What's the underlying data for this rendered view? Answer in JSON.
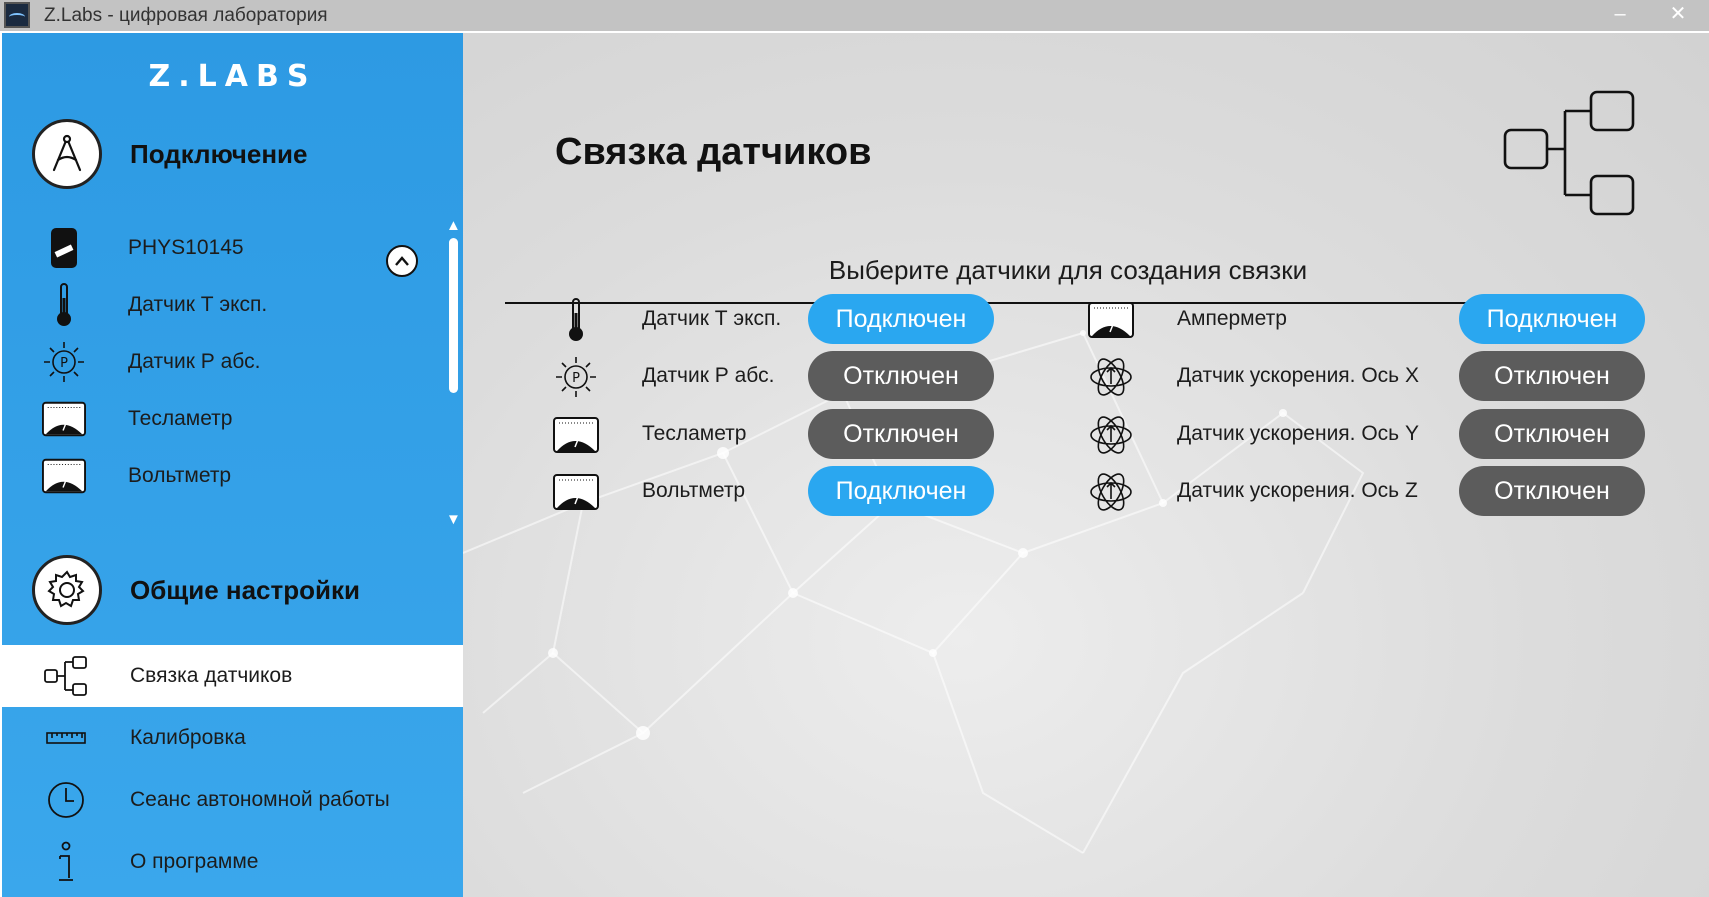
{
  "window": {
    "title": "Z.Labs - цифровая лаборатория",
    "minimize_glyph": "–",
    "close_glyph": "✕"
  },
  "sidebar": {
    "logo": "Z.LABS",
    "connection": {
      "title": "Подключение",
      "icon": "compass-icon",
      "device": {
        "label": "PHYS10145",
        "icon": "device-icon"
      },
      "sensors": [
        {
          "label": "Датчик Т эксп.",
          "icon": "thermometer-icon"
        },
        {
          "label": "Датчик Р абс.",
          "icon": "pressure-icon"
        },
        {
          "label": "Тесламетр",
          "icon": "gauge-icon"
        },
        {
          "label": "Вольтметр",
          "icon": "gauge-icon"
        }
      ]
    },
    "settings": {
      "title": "Общие настройки",
      "icon": "gear-icon",
      "items": [
        {
          "label": "Связка датчиков",
          "icon": "tree-icon",
          "active": true
        },
        {
          "label": "Калибровка",
          "icon": "ruler-icon",
          "active": false
        },
        {
          "label": "Сеанс автономной работы",
          "icon": "clock-icon",
          "active": false
        },
        {
          "label": "О программе",
          "icon": "info-icon",
          "active": false
        }
      ]
    }
  },
  "main": {
    "title": "Связка датчиков",
    "subtitle": "Выберите датчики для создания связки",
    "left_sensors": [
      {
        "label": "Датчик Т эксп.",
        "icon": "thermometer-icon",
        "status": "Подключен",
        "connected": true
      },
      {
        "label": "Датчик Р абс.",
        "icon": "pressure-icon",
        "status": "Отключен",
        "connected": false
      },
      {
        "label": "Тесламетр",
        "icon": "gauge-icon",
        "status": "Отключен",
        "connected": false
      },
      {
        "label": "Вольтметр",
        "icon": "gauge-icon",
        "status": "Подключен",
        "connected": true
      }
    ],
    "right_sensors": [
      {
        "label": "Амперметр",
        "icon": "gauge-icon",
        "status": "Подключен",
        "connected": true
      },
      {
        "label": "Датчик ускорения. Ось X",
        "icon": "accelerometer-icon",
        "status": "Отключен",
        "connected": false
      },
      {
        "label": "Датчик ускорения. Ось Y",
        "icon": "accelerometer-icon",
        "status": "Отключен",
        "connected": false
      },
      {
        "label": "Датчик ускорения. Ось Z",
        "icon": "accelerometer-icon",
        "status": "Отключен",
        "connected": false
      }
    ]
  },
  "colors": {
    "sidebar": "#2d9ae3",
    "connected": "#2aa7f0",
    "disconnected": "#5c5c5c",
    "titlebar": "#c3c3c3"
  }
}
